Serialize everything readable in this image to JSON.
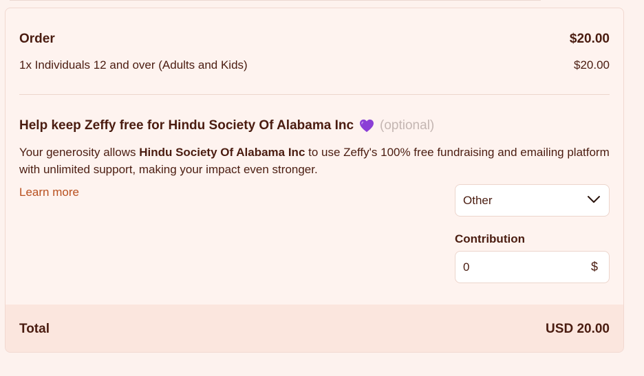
{
  "order": {
    "title": "Order",
    "total": "$20.00",
    "item_label": "1x Individuals 12 and over (Adults and Kids)",
    "item_price": "$20.00"
  },
  "tip": {
    "title": "Help keep Zeffy free for Hindu Society Of Alabama Inc",
    "heart_icon": "purple-heart-icon",
    "optional_label": "(optional)",
    "desc_prefix": "Your generosity allows ",
    "desc_org": "Hindu Society Of Alabama Inc",
    "desc_suffix": " to use Zeffy's 100% free fundraising and emailing platform with unlimited support, making your impact even stronger.",
    "learn_more": "Learn more",
    "select_value": "Other",
    "contribution_label": "Contribution",
    "contribution_value": "0",
    "currency_symbol": "$"
  },
  "total": {
    "label": "Total",
    "value": "USD 20.00"
  },
  "colors": {
    "text": "#4a1c10",
    "link": "#b8501f",
    "heart": "#8b3fd6",
    "background": "#fdf2ee",
    "total_bar": "#fbe6de"
  }
}
